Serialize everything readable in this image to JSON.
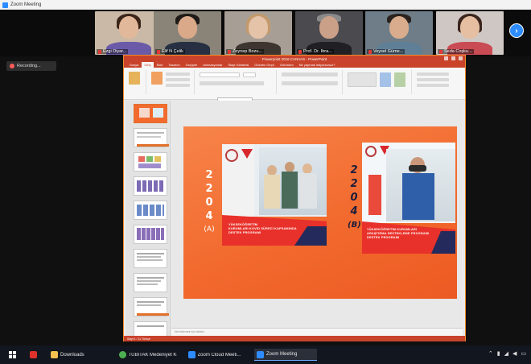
{
  "window": {
    "title": "Zoom Meeting"
  },
  "participants": [
    {
      "name": "Ezgi Diyar...",
      "bg": "#c9b9a6",
      "skin": "#e2b89a",
      "hair": "#3b2418",
      "shirt": "#6a5aa8"
    },
    {
      "name": "Elif N Çelik",
      "bg": "#8a8478",
      "skin": "#d9a98a",
      "hair": "#1e1a17",
      "shirt": "#263042"
    },
    {
      "name": "Zeynep Bozu...",
      "bg": "#a79e95",
      "skin": "#e4c3a9",
      "hair": "#c49a6c",
      "shirt": "#3c3530"
    },
    {
      "name": "Prof. Dr. İbra...",
      "bg": "#4b4a4e",
      "skin": "#caa088",
      "hair": "#8a8a8a",
      "shirt": "#1f1f24"
    },
    {
      "name": "Veysel Güme...",
      "bg": "#6e7d88",
      "skin": "#d8ac8c",
      "hair": "#2a221e",
      "shirt": "#5e7f96"
    },
    {
      "name": "Seda Coşku...",
      "bg": "#cfc7c3",
      "skin": "#e6bea2",
      "hair": "#3a261d",
      "shirt": "#c94b54"
    }
  ],
  "recording": {
    "label": "Recording..."
  },
  "ppt": {
    "title": "Powerpoint 2016 CANVAS - PowerPoint",
    "tabs": [
      "Dosya",
      "Giriş",
      "Ekle",
      "Tasarım",
      "Geçişler",
      "Animasyonlar",
      "Slayt Gösterisi",
      "Gözden Geçir",
      "Görünüm",
      "Ne yapmak istiyorsunuz?"
    ],
    "notes_placeholder": "Not eklemek için tıklatın",
    "status": "Slayt 1 / 11     Türkçe"
  },
  "slide": {
    "panel_a": {
      "digits": [
        "2",
        "2",
        "0",
        "4"
      ],
      "tag": "(A)",
      "caption": [
        "YÜKSEKÖĞRETİM",
        "KURUMLARI KOVİD SÜRECİ KAPSAMINDA",
        "DESTEK PROGRAMI"
      ]
    },
    "panel_b": {
      "digits": [
        "2",
        "2",
        "0",
        "4"
      ],
      "tag": "(B)",
      "caption": [
        "YÜKSEKÖĞRETİM KURUMLARI",
        "ARAŞTIRMA DESTEKLEME PROGRAMI",
        "DESTEK PROGRAMI"
      ]
    },
    "colors": {
      "orange": "#f26a2e",
      "navy": "#242a5c",
      "red": "#e8312a"
    }
  },
  "taskbar": {
    "items": [
      {
        "label": "Downloads",
        "color": "#f2c14e"
      },
      {
        "label": "TÜBİTAK Medeniyet Kı...",
        "color": "#4caf50"
      },
      {
        "label": "Zoom Cloud Meeti...",
        "color": "#2d8cff"
      },
      {
        "label": "Zoom Meeting",
        "color": "#2d8cff"
      }
    ]
  }
}
